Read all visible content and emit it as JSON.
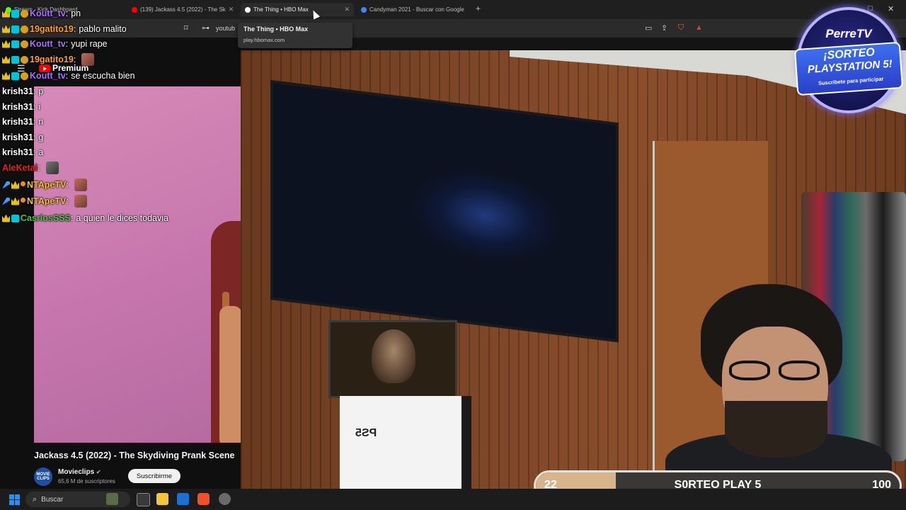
{
  "browser": {
    "tabs": [
      {
        "title": "Stream - Kick Dashboard",
        "active": false,
        "color": "#53fc18"
      },
      {
        "title": "(139) Jackass 4.5 (2022) - The Sk",
        "active": false,
        "color": "#ff0000"
      },
      {
        "title": "The Thing • HBO Max",
        "active": true,
        "color": "#ffffff"
      },
      {
        "title": "Candyman 2021 - Buscar con Google",
        "active": false,
        "color": "#4285f4"
      }
    ],
    "new_tab": "+",
    "minimize": "—",
    "maximize": "□",
    "close": "✕",
    "address": "youtub",
    "tooltip": {
      "title": "The Thing • HBO Max",
      "url": "play.hbomax.com"
    }
  },
  "youtube": {
    "brand": "Premium",
    "video_title": "Jackass 4.5 (2022) - The Skydiving Prank Scene",
    "channel_name": "Movieclips",
    "channel_verified": "✔",
    "channel_avatar": "MOVIE CLIPS",
    "subscribers": "65,6 M de suscriptores",
    "subscribe_label": "Suscribirme"
  },
  "chat": [
    {
      "name": "Koutt_tv",
      "color": "#a970ff",
      "message": "pn",
      "badges": [
        "crown",
        "grid",
        "coin"
      ],
      "emote": ""
    },
    {
      "name": "19gatito19",
      "color": "#ff9f2a",
      "message": "pablo malito",
      "badges": [
        "crown",
        "grid",
        "coin"
      ],
      "emote": ""
    },
    {
      "name": "Koutt_tv",
      "color": "#a970ff",
      "message": "yupi rape",
      "badges": [
        "crown",
        "grid",
        "coin"
      ],
      "emote": ""
    },
    {
      "name": "19gatito19",
      "color": "#ff9f2a",
      "message": "",
      "badges": [
        "crown",
        "grid",
        "coin"
      ],
      "emote": "emote"
    },
    {
      "name": "Koutt_tv",
      "color": "#a970ff",
      "message": "se escucha bien",
      "badges": [
        "crown",
        "grid",
        "coin"
      ],
      "emote": ""
    },
    {
      "name": "krish31",
      "color": "#ffffff",
      "message": "p",
      "badges": [],
      "emote": ""
    },
    {
      "name": "krish31",
      "color": "#ffffff",
      "message": "i",
      "badges": [],
      "emote": ""
    },
    {
      "name": "krish31",
      "color": "#ffffff",
      "message": "n",
      "badges": [],
      "emote": ""
    },
    {
      "name": "krish31",
      "color": "#ffffff",
      "message": "g",
      "badges": [],
      "emote": ""
    },
    {
      "name": "krish31",
      "color": "#ffffff",
      "message": "a",
      "badges": [],
      "emote": ""
    },
    {
      "name": "AleKetai",
      "color": "#e02424",
      "message": "",
      "badges": [],
      "emote": "grey"
    },
    {
      "name": "NTApeTV",
      "color": "#f2c12e",
      "message": "",
      "badges": [
        "sword",
        "crown",
        "dot"
      ],
      "emote": "emote"
    },
    {
      "name": "NTApeTV",
      "color": "#f2c12e",
      "message": "",
      "badges": [
        "sword",
        "crown",
        "dot"
      ],
      "emote": "emote"
    },
    {
      "name": "CasrlosSSS",
      "color": "#53c24a",
      "message": "a quien le dices todavia",
      "badges": [
        "crown",
        "grid"
      ],
      "emote": ""
    }
  ],
  "promo": {
    "brand": "PerreTV",
    "line1": "¡SORTEO",
    "line2": "PLAYSTATION 5!",
    "sub": "Suscribete para participar"
  },
  "goal": {
    "current": "22",
    "label": "S0RTEO PLAY 5",
    "target": "100",
    "fill_fraction": 0.22,
    "fill_color": "#d7b48a"
  },
  "scene": {
    "ps5_box_label": "PS5"
  },
  "taskbar": {
    "search_placeholder": "Buscar",
    "apps": [
      "folder",
      "task-view",
      "file-explorer",
      "outlook",
      "brave",
      "settings"
    ]
  }
}
